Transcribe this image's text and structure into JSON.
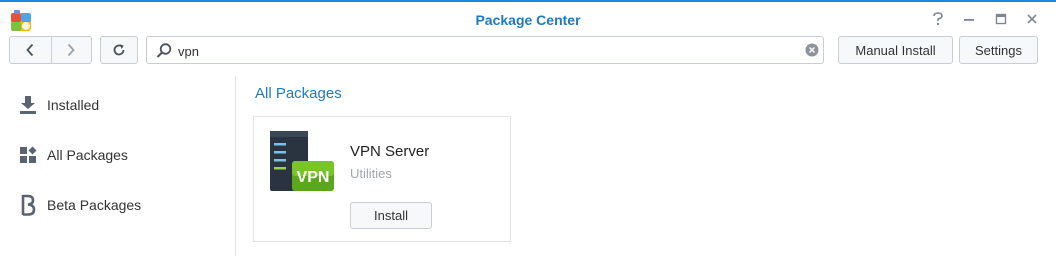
{
  "window": {
    "title": "Package Center",
    "icon": "package-center-icon",
    "controls": [
      "help-icon",
      "minimize-icon",
      "maximize-icon",
      "close-icon"
    ]
  },
  "toolbar": {
    "back_icon": "chevron-left-icon",
    "forward_icon": "chevron-right-icon",
    "refresh_icon": "refresh-icon",
    "search": {
      "value": "vpn",
      "placeholder": ""
    },
    "manual_install_label": "Manual Install",
    "settings_label": "Settings"
  },
  "sidebar": {
    "items": [
      {
        "label": "Installed",
        "icon": "download-icon"
      },
      {
        "label": "All Packages",
        "icon": "grid-icon"
      },
      {
        "label": "Beta Packages",
        "icon": "beta-icon"
      }
    ]
  },
  "main": {
    "section_title": "All Packages",
    "packages": [
      {
        "name": "VPN Server",
        "category": "Utilities",
        "icon_text": "VPN",
        "action_label": "Install"
      }
    ]
  },
  "colors": {
    "accent": "#1f7ac4",
    "title_bar_border": "#1e88e5",
    "vpn_green": "#6fbf1f"
  }
}
